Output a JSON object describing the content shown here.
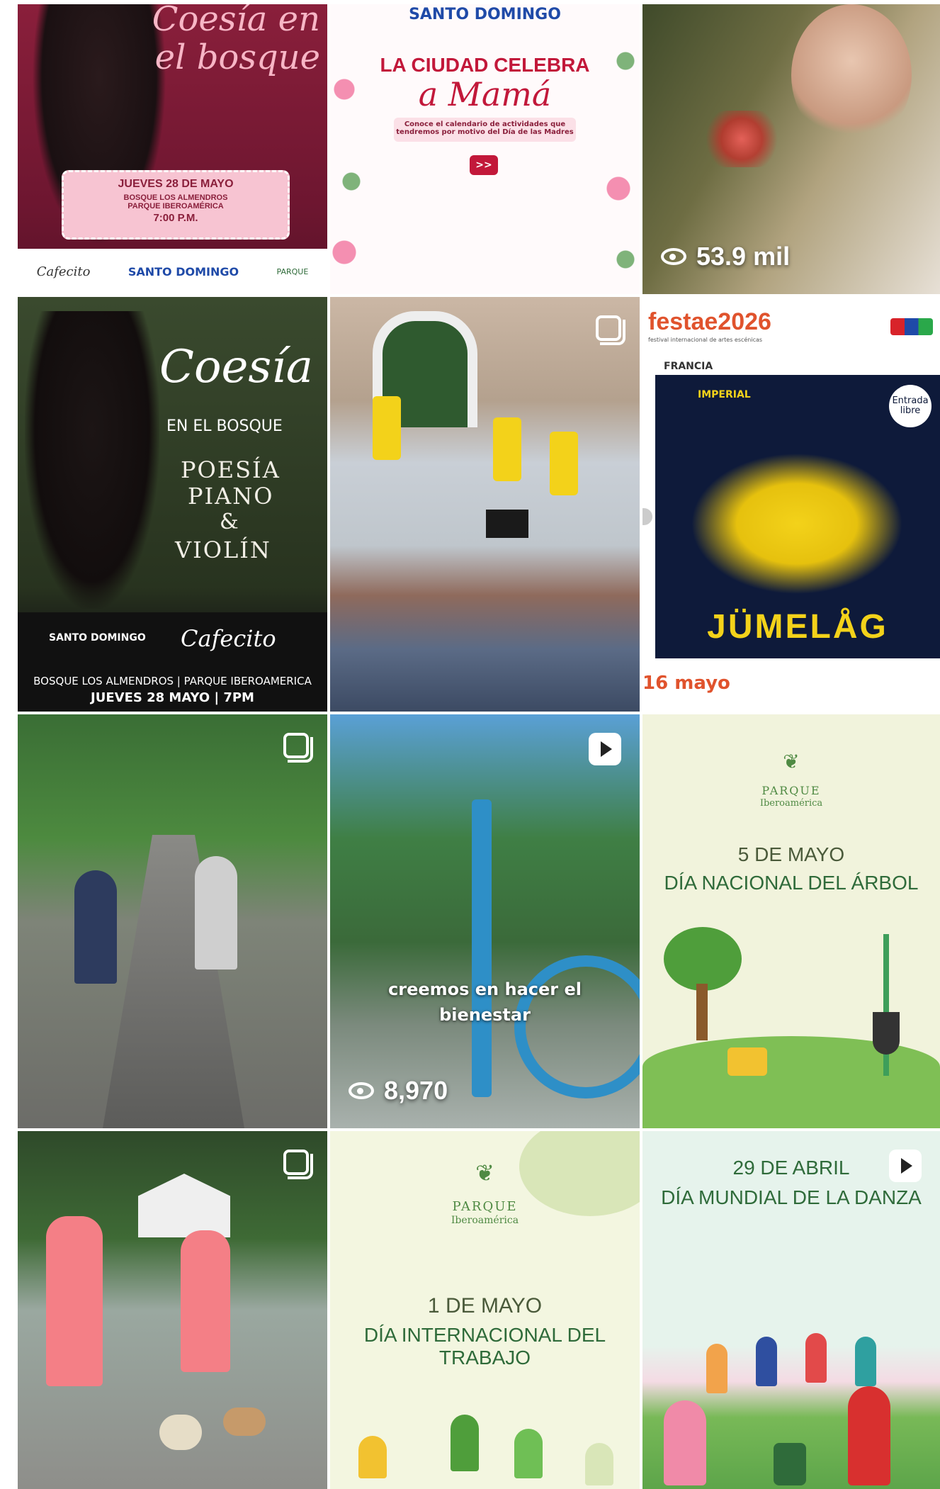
{
  "tiles": {
    "t1": {
      "title": "Coesía en el bosque",
      "date_line": "JUEVES 28 DE MAYO",
      "place1": "BOSQUE LOS ALMENDROS",
      "place2": "PARQUE IBEROAMÉRICA",
      "time": "7:00 P.M.",
      "logo1": "Cafecito",
      "logo2": "SANTO DOMINGO",
      "logo3": "PARQUE"
    },
    "t2": {
      "header": "SANTO DOMINGO",
      "line1": "LA CIUDAD CELEBRA",
      "line2": "a Mamá",
      "sub": "Conoce el calendario de actividades que tendremos por motivo del Día de las Madres",
      "btn": ">>"
    },
    "t3": {
      "views": "53.9 mil"
    },
    "t4": {
      "title": "Coesía",
      "sub": "EN EL BOSQUE",
      "poesia": "POESÍA",
      "piano": "PIANO",
      "amp": "&",
      "violin": "VIOLÍN",
      "brand1": "SANTO DOMINGO",
      "brand2": "Cafecito",
      "place": "BOSQUE LOS ALMENDROS | PARQUE IBEROAMERICA",
      "date": "JUEVES 28 MAYO | 7PM"
    },
    "t5": {},
    "t6": {
      "brand": "festae2026",
      "sub": "festival internacional de artes escénicas",
      "country": "FRANCIA",
      "badge1": "IMPERIAL",
      "badge2": "Entrada libre",
      "name": "JÜMELÅG",
      "date": "16 mayo"
    },
    "t7": {},
    "t8": {
      "caption1": "creemos en hacer el",
      "caption2": "bienestar",
      "views": "8,970"
    },
    "t9": {
      "brand": "PARQUE",
      "brand2": "Iberoamérica",
      "date": "5 DE MAYO",
      "title": "DÍA NACIONAL DEL ÁRBOL"
    },
    "t10": {},
    "t11": {
      "brand": "PARQUE",
      "brand2": "Iberoamérica",
      "date": "1 DE MAYO",
      "title": "DÍA INTERNACIONAL DEL TRABAJO"
    },
    "t12": {
      "date": "29 DE ABRIL",
      "title": "DÍA MUNDIAL DE LA DANZA"
    }
  },
  "colors": {
    "maroon": "#7a1e33",
    "pink": "#f4b6c8",
    "olive_bg": "#f1f3dc",
    "green_text": "#2f6b3a",
    "mint_bg": "#e6f3ec"
  }
}
